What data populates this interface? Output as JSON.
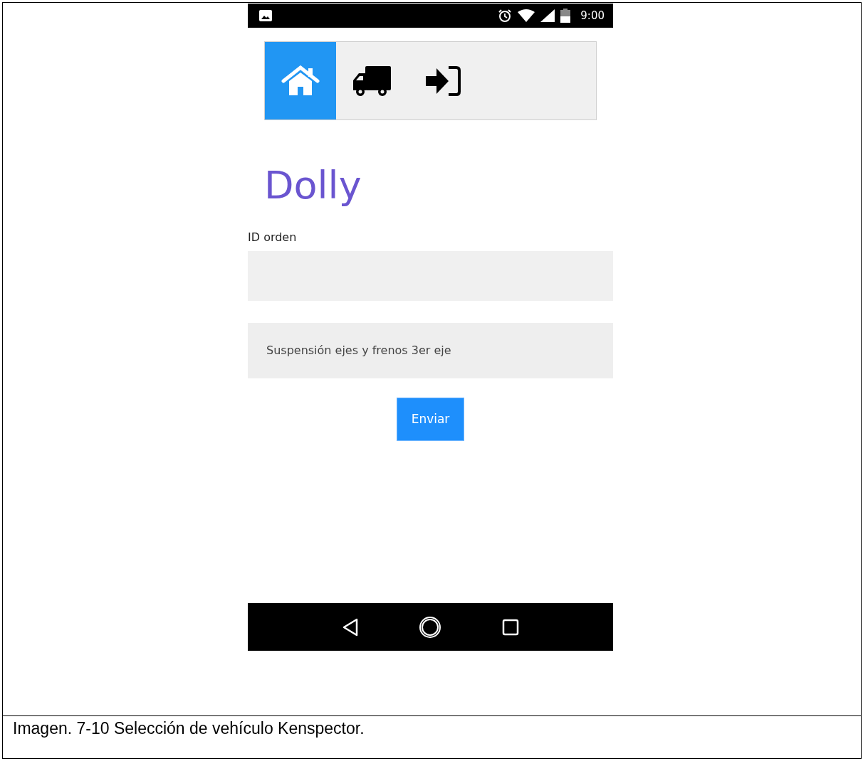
{
  "status_bar": {
    "time": "9:00"
  },
  "nav_tabs": [
    {
      "kind": "home",
      "selected": true
    },
    {
      "kind": "truck",
      "selected": false
    },
    {
      "kind": "sign-in",
      "selected": false
    }
  ],
  "title": "Dolly",
  "form": {
    "id_label": "ID orden",
    "inspection_value": "Suspensión ejes y frenos 3er eje",
    "submit": "Enviar"
  },
  "caption": "Imagen. 7-10 Selección de vehículo Kenspector."
}
